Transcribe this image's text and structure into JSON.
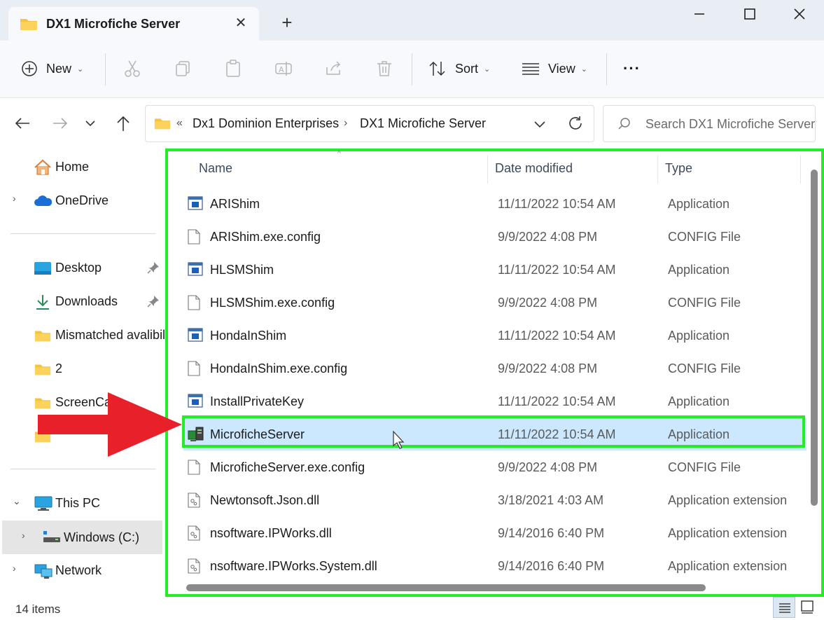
{
  "window": {
    "tab_title": "DX1 Microfiche Server",
    "tab_close": "✕",
    "new_tab": "+"
  },
  "toolbar": {
    "new_label": "New",
    "sort_label": "Sort",
    "view_label": "View",
    "more_label": "···"
  },
  "address": {
    "overflow": "«",
    "crumbs": [
      "Dx1 Dominion Enterprises",
      "DX1 Microfiche Server"
    ],
    "separator": "›"
  },
  "search": {
    "placeholder": "Search DX1 Microfiche Server"
  },
  "sidebar": {
    "items": [
      {
        "label": "Home",
        "icon": "home-icon"
      },
      {
        "label": "OneDrive",
        "icon": "cloud-icon"
      },
      {
        "label": "Desktop",
        "icon": "desktop-icon",
        "pinned": true
      },
      {
        "label": "Downloads",
        "icon": "download-icon",
        "pinned": true
      },
      {
        "label": "Mismatched avalibility",
        "icon": "folder-icon"
      },
      {
        "label": "2",
        "icon": "folder-icon"
      },
      {
        "label": "ScreenCaps",
        "icon": "folder-icon"
      },
      {
        "label": "",
        "icon": "folder-icon"
      },
      {
        "label": "This PC",
        "icon": "pc-icon"
      },
      {
        "label": "Windows  (C:)",
        "icon": "drive-icon"
      },
      {
        "label": "Network",
        "icon": "network-icon"
      }
    ]
  },
  "columns": {
    "name": "Name",
    "date": "Date modified",
    "type": "Type"
  },
  "files": [
    {
      "name": "ARIShim",
      "date": "11/11/2022 10:54 AM",
      "type": "Application",
      "icon": "app-icon"
    },
    {
      "name": "ARIShim.exe.config",
      "date": "9/9/2022 4:08 PM",
      "type": "CONFIG File",
      "icon": "file-icon"
    },
    {
      "name": "HLSMShim",
      "date": "11/11/2022 10:54 AM",
      "type": "Application",
      "icon": "app-icon"
    },
    {
      "name": "HLSMShim.exe.config",
      "date": "9/9/2022 4:08 PM",
      "type": "CONFIG File",
      "icon": "file-icon"
    },
    {
      "name": "HondaInShim",
      "date": "11/11/2022 10:54 AM",
      "type": "Application",
      "icon": "app-icon"
    },
    {
      "name": "HondaInShim.exe.config",
      "date": "9/9/2022 4:08 PM",
      "type": "CONFIG File",
      "icon": "file-icon"
    },
    {
      "name": "InstallPrivateKey",
      "date": "11/11/2022 10:54 AM",
      "type": "Application",
      "icon": "app-icon"
    },
    {
      "name": "MicroficheServer",
      "date": "11/11/2022 10:54 AM",
      "type": "Application",
      "icon": "server-app-icon",
      "selected": true
    },
    {
      "name": "MicroficheServer.exe.config",
      "date": "9/9/2022 4:08 PM",
      "type": "CONFIG File",
      "icon": "file-icon"
    },
    {
      "name": "Newtonsoft.Json.dll",
      "date": "3/18/2021 4:03 AM",
      "type": "Application extension",
      "icon": "dll-icon"
    },
    {
      "name": "nsoftware.IPWorks.dll",
      "date": "9/14/2016 6:40 PM",
      "type": "Application extension",
      "icon": "dll-icon"
    },
    {
      "name": "nsoftware.IPWorks.System.dll",
      "date": "9/14/2016 6:40 PM",
      "type": "Application extension",
      "icon": "dll-icon"
    }
  ],
  "status": {
    "item_count": "14 items"
  },
  "colors": {
    "highlight_green": "#22ee22",
    "arrow_red": "#e8202a",
    "selection_blue": "#cce8ff",
    "folder_yellow": "#f8c33a"
  }
}
